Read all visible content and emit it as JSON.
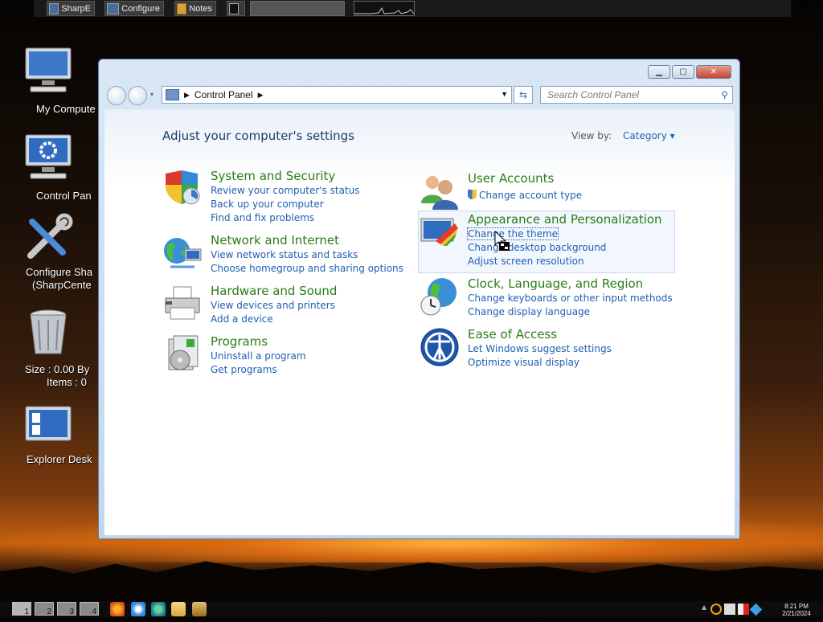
{
  "top_taskbar": {
    "items": [
      {
        "label": "SharpE",
        "icon": "monitor-icon"
      },
      {
        "label": "Configure",
        "icon": "monitor-icon"
      },
      {
        "label": "Notes",
        "icon": "notes-icon"
      },
      {
        "label": "",
        "icon": "terminal-icon"
      }
    ]
  },
  "desktop": {
    "icons": [
      {
        "label": "My Compute",
        "icon": "computer-icon"
      },
      {
        "label": "Control Pan",
        "icon": "control-panel-icon"
      },
      {
        "label": "Configure Sha",
        "label2": "(SharpCente",
        "icon": "tools-icon"
      },
      {
        "label": "Size : 0.00 By",
        "label2": "Items : 0",
        "icon": "recycle-bin-icon"
      },
      {
        "label": "Explorer Desk",
        "icon": "explorer-icon"
      }
    ]
  },
  "window": {
    "address": {
      "crumb": "Control Panel"
    },
    "search": {
      "placeholder": "Search Control Panel"
    },
    "heading": "Adjust your computer's settings",
    "view_by": {
      "label": "View by:",
      "value": "Category"
    },
    "categories_left": [
      {
        "title": "System and Security",
        "links": [
          "Review your computer's status",
          "Back up your computer",
          "Find and fix problems"
        ],
        "icon": "shield-icon"
      },
      {
        "title": "Network and Internet",
        "links": [
          "View network status and tasks",
          "Choose homegroup and sharing options"
        ],
        "icon": "network-globe-icon"
      },
      {
        "title": "Hardware and Sound",
        "links": [
          "View devices and printers",
          "Add a device"
        ],
        "icon": "printer-icon"
      },
      {
        "title": "Programs",
        "links": [
          "Uninstall a program",
          "Get programs"
        ],
        "icon": "programs-icon"
      }
    ],
    "categories_right": [
      {
        "title": "User Accounts",
        "links": [
          "Change account type"
        ],
        "icon": "users-icon"
      },
      {
        "title": "Appearance and Personalization",
        "links": [
          "Change the theme",
          "Change desktop background",
          "Adjust screen resolution"
        ],
        "icon": "appearance-icon"
      },
      {
        "title": "Clock, Language, and Region",
        "links": [
          "Change keyboards or other input methods",
          "Change display language"
        ],
        "icon": "clock-globe-icon"
      },
      {
        "title": "Ease of Access",
        "links": [
          "Let Windows suggest settings",
          "Optimize visual display"
        ],
        "icon": "ease-of-access-icon"
      }
    ]
  },
  "bottom_taskbar": {
    "workspaces": [
      "1",
      "2",
      "3",
      "4"
    ],
    "quicklaunch": [
      "firefox-icon",
      "ie-icon",
      "browser-icon",
      "folder-icon",
      "media-icon"
    ],
    "clock": {
      "time": "8:21 PM",
      "date": "2/21/2024"
    }
  }
}
